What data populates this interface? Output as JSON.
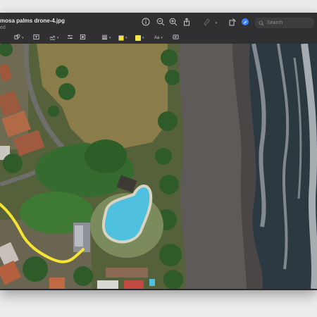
{
  "window": {
    "title": "mosa palms drone-4.jpg",
    "subtitle": "ed"
  },
  "toolbar": {
    "search_placeholder": "Search",
    "text_style_label": "Aa"
  },
  "colors": {
    "annotation_stroke": "#f5e431",
    "highlight_color": "#f3e84a",
    "accent_blue": "#3b82f6",
    "pool_water": "#4fc0dd",
    "ocean": "#2d3940"
  },
  "icons": [
    "info-icon",
    "zoom-out-icon",
    "zoom-in-icon",
    "share-icon",
    "highlighter-icon",
    "chevron-down-icon",
    "rotate-icon",
    "markup-icon",
    "search-icon",
    "shapes-icon",
    "text-box-icon",
    "sign-icon",
    "adjust-icon",
    "crop-icon",
    "border-style-icon",
    "border-color-icon",
    "fill-color-icon",
    "text-style-icon",
    "description-icon"
  ]
}
